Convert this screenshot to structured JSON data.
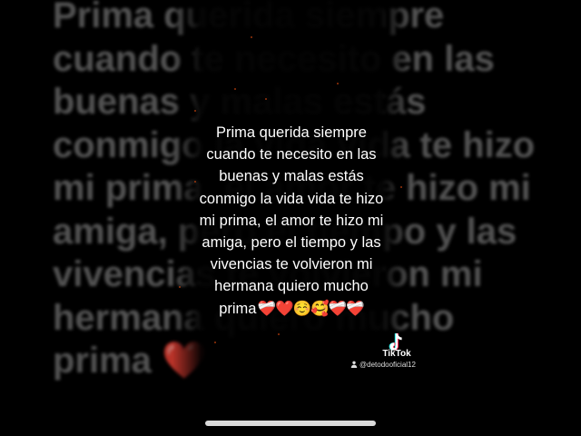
{
  "caption": {
    "lines": [
      "Prima querida  siempre",
      "cuando te necesito en las",
      "buenas y malas  estás",
      "conmigo  la vida   vida te hizo",
      "mi prima, el amor te hizo mi",
      "amiga, pero el tiempo y las",
      "vivencias te volvieron mi",
      "hermana quiero mucho",
      "prima"
    ],
    "emojis": "❤️‍🩹❤️☺️🥰❤️‍🩹❤️‍🩹"
  },
  "background_text": {
    "lines": [
      "Prima querida  siempre",
      "cuando te necesito en las",
      "buenas y malas  estás",
      "conmigo  la vida   vida te hizo",
      "mi prima, el amor te hizo mi",
      "amiga, pero el tiempo y las",
      "vivencias te volvieron mi",
      "hermana quiero mucho",
      "prima ❤️"
    ]
  },
  "watermark": {
    "brand": "TikTok",
    "handle": "@detodooficial12",
    "logo_icon": "tiktok-note-icon",
    "user_icon": "person-icon"
  },
  "colors": {
    "background": "#000000",
    "caption_text": "#ffffff",
    "background_text": "#6e6e6e",
    "ember": "#c2410c",
    "progress_bar": "#d9d9d9"
  }
}
